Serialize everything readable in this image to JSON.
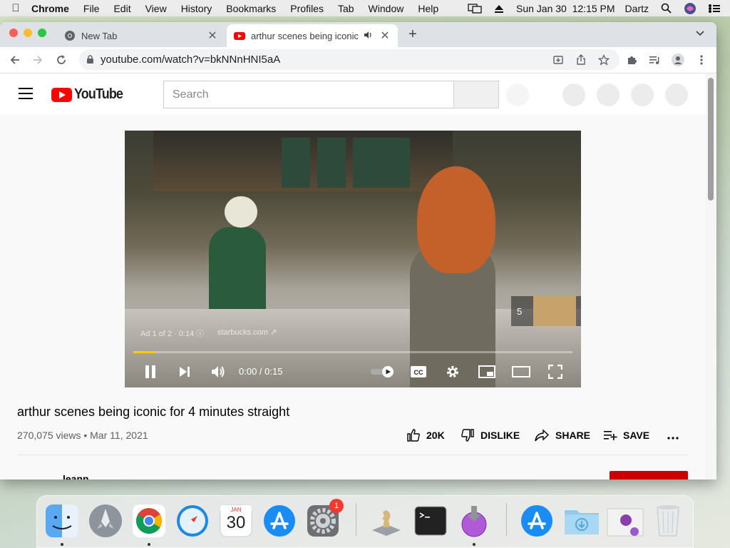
{
  "menubar": {
    "app_name": "Chrome",
    "items": [
      "File",
      "Edit",
      "View",
      "History",
      "Bookmarks",
      "Profiles",
      "Tab",
      "Window",
      "Help"
    ],
    "clock": "Sun Jan 30  12:15 PM",
    "user": "Dartz"
  },
  "tabs": [
    {
      "title": "New Tab",
      "icon": "chrome-icon",
      "active": false
    },
    {
      "title": "arthur scenes being iconic",
      "icon": "youtube-icon",
      "active": true,
      "audio": true
    }
  ],
  "toolbar": {
    "url": "youtube.com/watch?v=bkNNnHNI5aA"
  },
  "youtube": {
    "logo_text": "YouTube",
    "search_placeholder": "Search"
  },
  "player": {
    "ad_info": "Ad 1 of 2 · 0:14",
    "ad_link": "starbucks.com",
    "skip_countdown": "5",
    "timecode": "0:00 / 0:15",
    "progress_fraction": 0.05,
    "progress_color": "#ffcc00"
  },
  "video": {
    "title": "arthur scenes being iconic for 4 minutes straight",
    "meta": "270,075 views • Mar 11, 2021",
    "likes": "20K",
    "dislike_label": "DISLIKE",
    "share_label": "SHARE",
    "save_label": "SAVE",
    "channel_partial": "leann"
  },
  "dock": {
    "apps": [
      "finder",
      "launchpad",
      "chrome",
      "safari",
      "calendar",
      "app-store",
      "system-preferences",
      "chess",
      "terminal",
      "installer",
      "app-store-downloads",
      "downloads-folder",
      "preview-stack",
      "trash"
    ],
    "calendar_month": "JAN",
    "calendar_day": "30",
    "sysprefs_badge": "1"
  },
  "colors": {
    "youtube_red": "#ff0000",
    "chrome_tabstrip": "#dee1e6",
    "omnibox_bg": "#f1f3f4"
  }
}
